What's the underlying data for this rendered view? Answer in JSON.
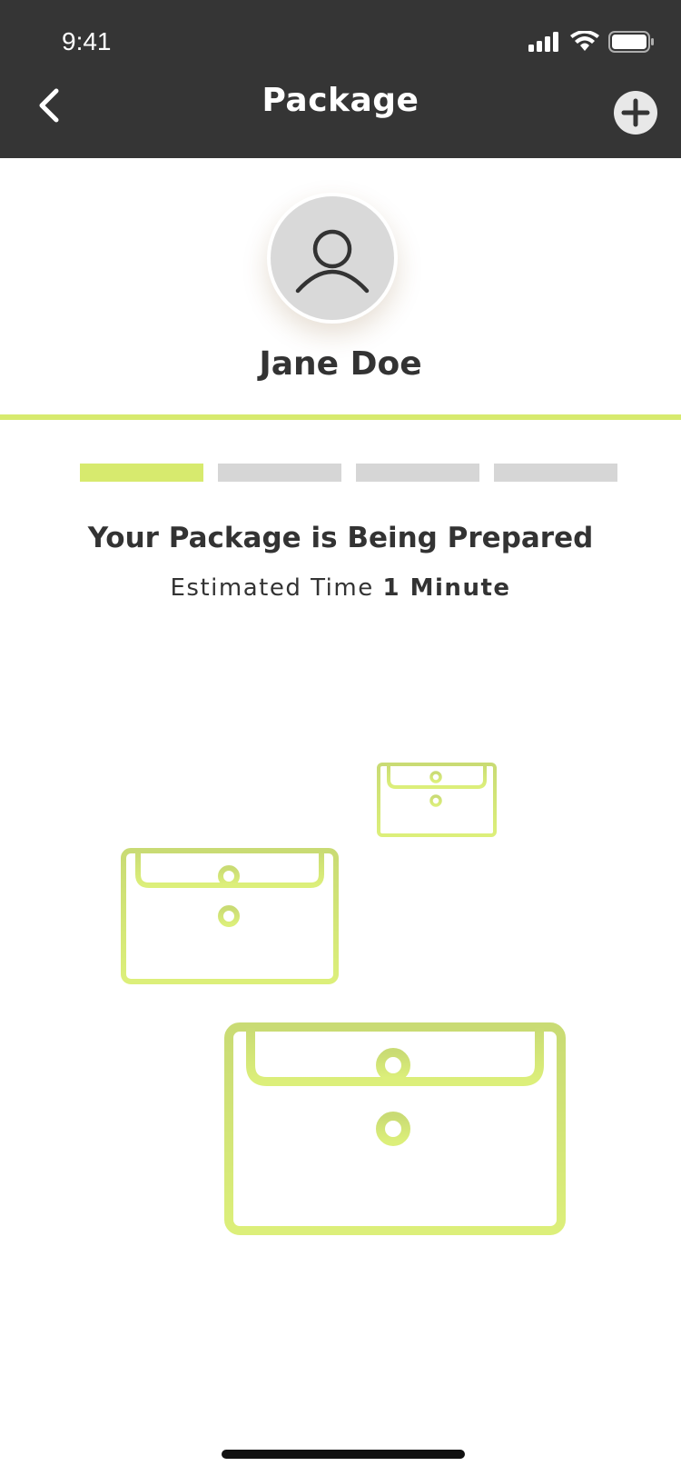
{
  "status_bar": {
    "time": "9:41"
  },
  "header": {
    "title": "Package",
    "back_icon": "chevron-left-icon",
    "add_icon": "plus-circle-icon"
  },
  "profile": {
    "name": "Jane Doe",
    "avatar_icon": "user-icon"
  },
  "progress": {
    "steps_total": 4,
    "steps_completed": 1
  },
  "status": {
    "heading": "Your Package is Being Prepared",
    "eta_label": "Estimated Time",
    "eta_value": "1 Minute"
  },
  "illustration": {
    "icon": "envelope-icon",
    "count": 3
  },
  "colors": {
    "header_bg": "#353535",
    "accent": "#d7ea6e",
    "inactive_step": "#d6d6d6",
    "text": "#333333"
  }
}
